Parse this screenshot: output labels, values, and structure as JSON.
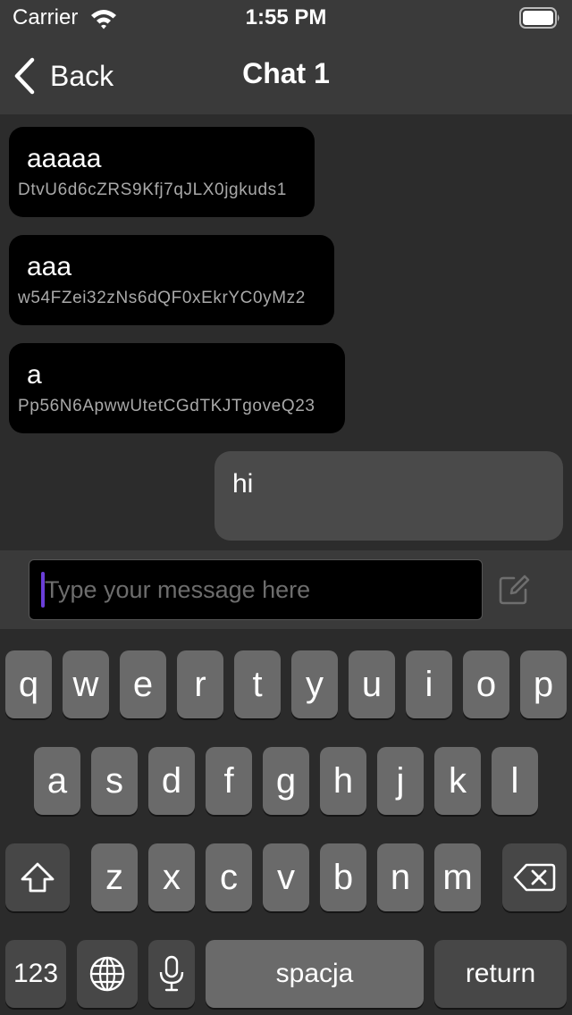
{
  "status_bar": {
    "carrier": "Carrier",
    "time": "1:55 PM",
    "wifi_icon": "wifi-icon",
    "battery_icon": "battery-icon"
  },
  "nav": {
    "back_label": "Back",
    "title": "Chat 1"
  },
  "messages": [
    {
      "text": "aaaaa",
      "sender": "DtvU6d6cZRS9Kfj7qJLX0jgkuds1",
      "direction": "incoming"
    },
    {
      "text": "aaa",
      "sender": "w54FZei32zNs6dQF0xEkrYC0yMz2",
      "direction": "incoming"
    },
    {
      "text": "a",
      "sender": "Pp56N6ApwwUtetCGdTKJTgoveQ23",
      "direction": "incoming"
    },
    {
      "text": "hi",
      "direction": "outgoing"
    }
  ],
  "input": {
    "value": "",
    "placeholder": "Type your message here",
    "send_icon": "compose-icon"
  },
  "keyboard": {
    "row1": [
      "q",
      "w",
      "e",
      "r",
      "t",
      "y",
      "u",
      "i",
      "o",
      "p"
    ],
    "row2": [
      "a",
      "s",
      "d",
      "f",
      "g",
      "h",
      "j",
      "k",
      "l"
    ],
    "row3": [
      "z",
      "x",
      "c",
      "v",
      "b",
      "n",
      "m"
    ],
    "numbers_label": "123",
    "space_label": "spacja",
    "return_label": "return",
    "shift_icon": "shift-icon",
    "delete_icon": "delete-icon",
    "globe_icon": "globe-icon",
    "mic_icon": "microphone-icon"
  },
  "colors": {
    "nav_bg": "#3a3a3a",
    "chat_bg": "#2c2c2c",
    "incoming_bubble": "#000000",
    "outgoing_bubble": "#4a4a4a",
    "caret": "#6a3ed8"
  }
}
